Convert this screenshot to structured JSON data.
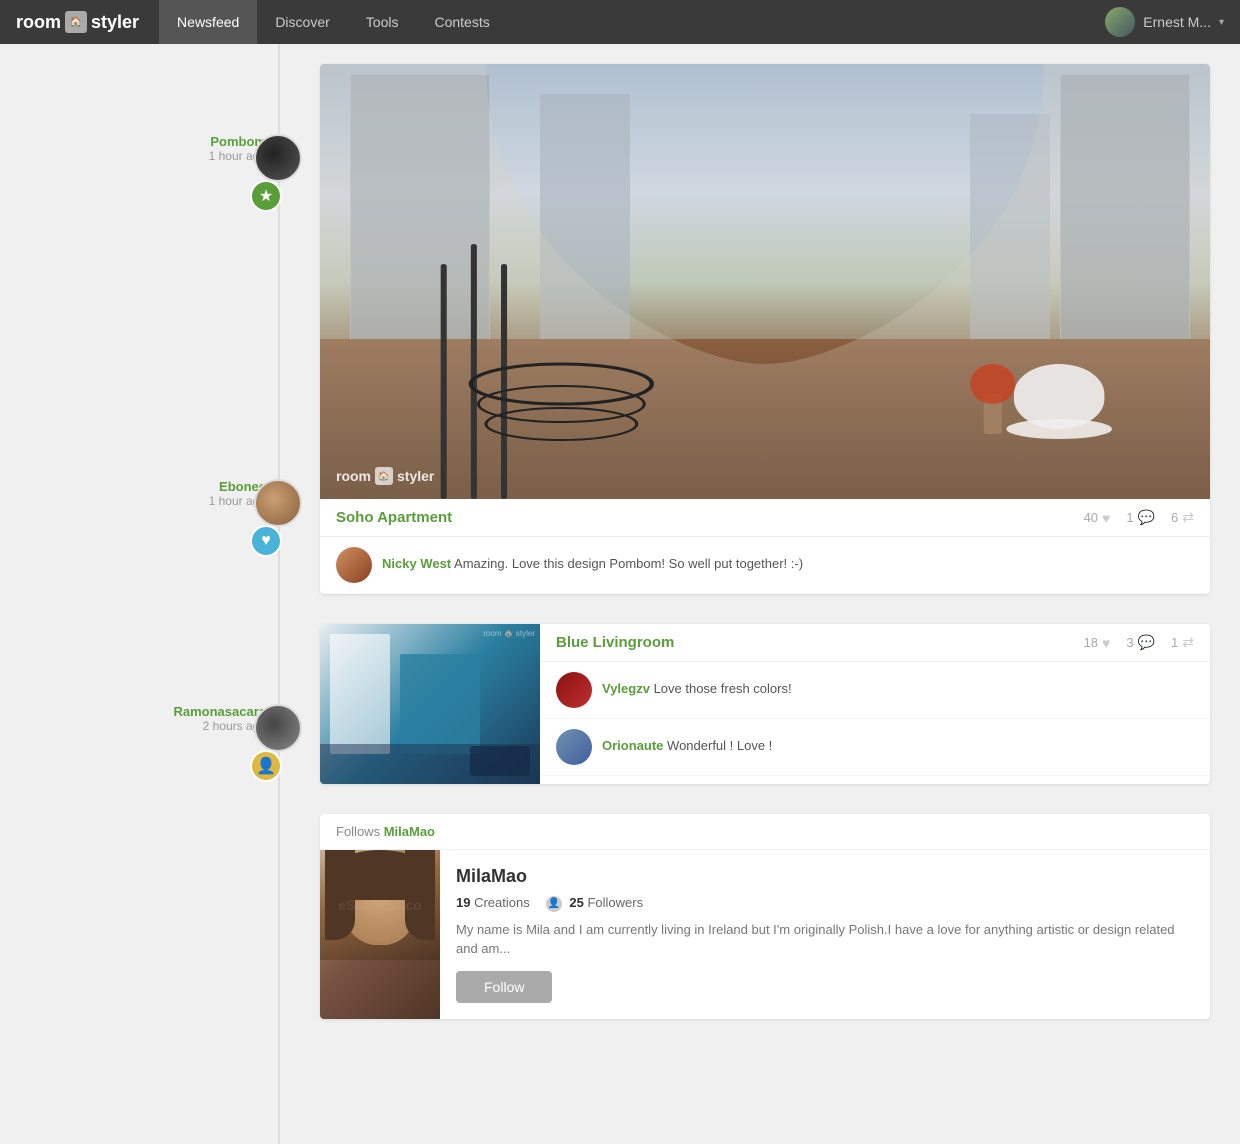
{
  "nav": {
    "logo_text_left": "room",
    "logo_text_right": "styler",
    "links": [
      {
        "label": "Newsfeed",
        "active": true
      },
      {
        "label": "Discover",
        "active": false
      },
      {
        "label": "Tools",
        "active": false
      },
      {
        "label": "Contests",
        "active": false
      }
    ],
    "user_name": "Ernest M...",
    "dropdown_icon": "▾"
  },
  "sidebar": {
    "entries": [
      {
        "name": "Pombom",
        "time": "1 hour ago",
        "badge_type": "star",
        "badge_icon": "★"
      },
      {
        "name": "Ebonee",
        "time": "1 hour ago",
        "badge_type": "heart",
        "badge_icon": "♥"
      },
      {
        "name": "Ramonasacara",
        "time": "2 hours ago",
        "badge_type": "person",
        "badge_icon": "👤"
      }
    ]
  },
  "feed": {
    "card_soho": {
      "title": "Soho Apartment",
      "watermark": "room  styler",
      "stats": {
        "likes": "40",
        "comments": "1",
        "shares": "6"
      },
      "comment": {
        "author": "Nicky West",
        "text": "Amazing. Love this design Pombom! So well put together! :-)"
      }
    },
    "card_blue": {
      "title": "Blue Livingroom",
      "watermark": "room  styler",
      "stats": {
        "likes": "18",
        "comments": "3",
        "shares": "1"
      },
      "comments": [
        {
          "author": "Vylegzv",
          "text": "Love those fresh colors!"
        },
        {
          "author": "Orionaute",
          "text": "Wonderful ! Love !"
        }
      ]
    },
    "card_follow": {
      "follows_prefix": "Follows",
      "follows_name": "MilaMao",
      "profile": {
        "username": "MilaMao",
        "creations_label": "Creations",
        "creations_count": "19",
        "followers_label": "Followers",
        "followers_count": "25",
        "bio": "My name is Mila and I am currently living in Ireland but I'm originally Polish.I have a love for anything artistic or design related and am...",
        "follow_button": "Follow"
      }
    }
  },
  "icons": {
    "heart": "♥",
    "comment": "💬",
    "share": "⇄",
    "star": "★",
    "person": "👤",
    "logo_box": "🏠"
  }
}
